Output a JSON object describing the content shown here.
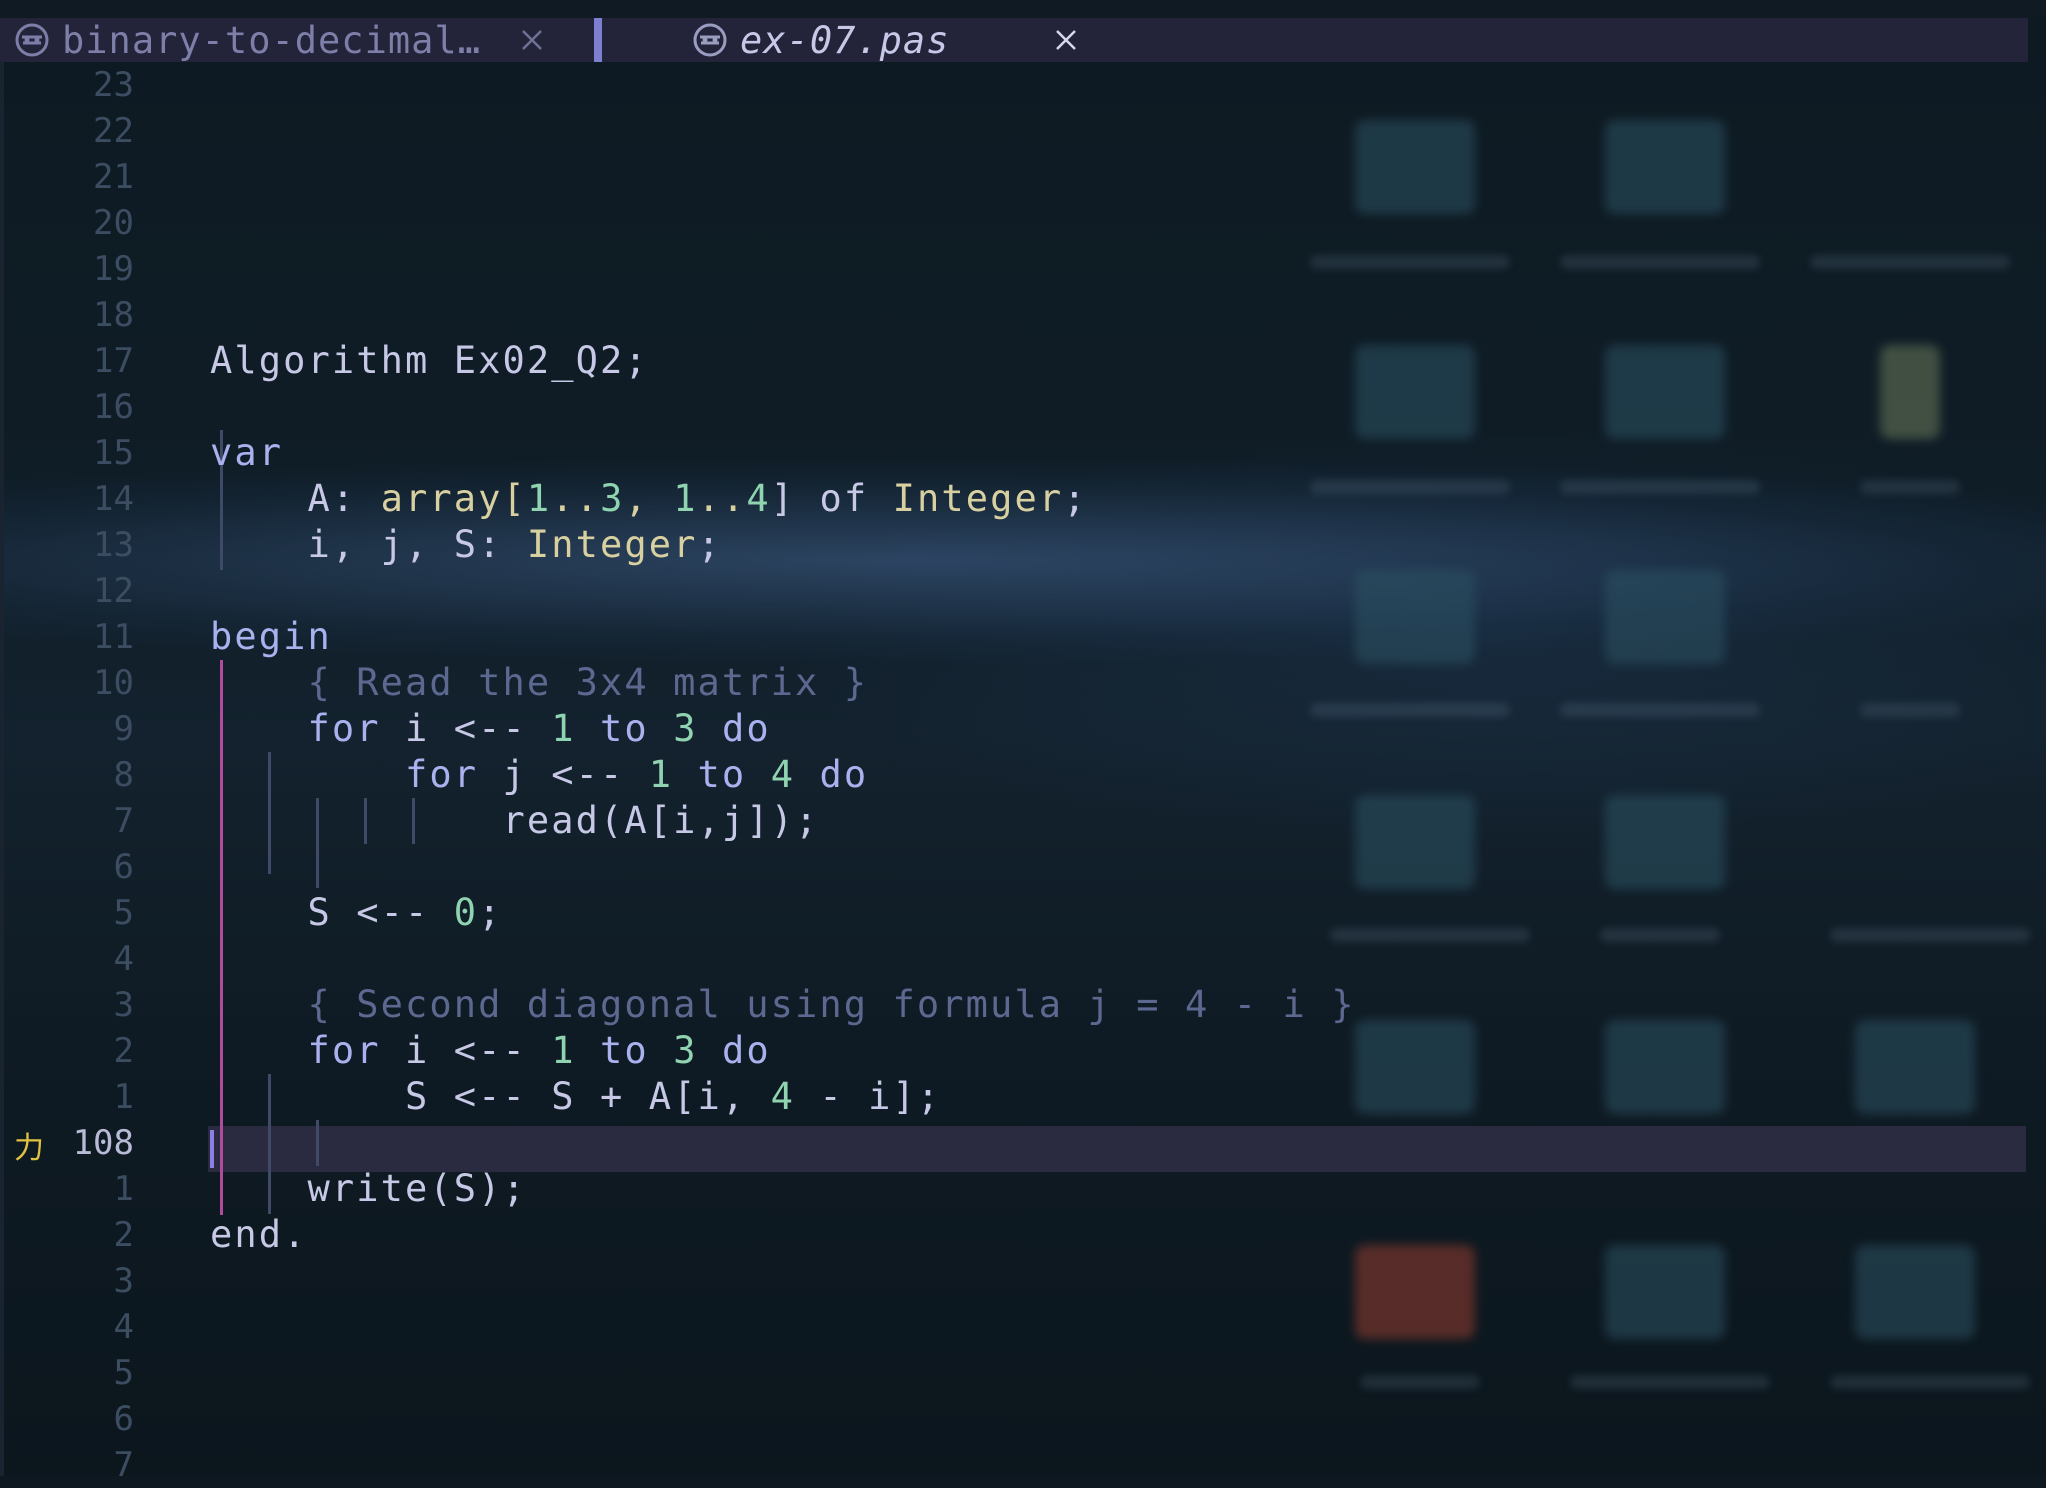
{
  "tabs": [
    {
      "label": "binary-to-decimal…",
      "active": false
    },
    {
      "label": "ex-07.pas",
      "active": true
    }
  ],
  "gutter": {
    "cursor_marker": "力",
    "numbers": [
      "23",
      "22",
      "21",
      "20",
      "19",
      "18",
      "17",
      "16",
      "15",
      "14",
      "13",
      "12",
      "11",
      "10",
      "9",
      "8",
      "7",
      "6",
      "5",
      "4",
      "3",
      "2",
      "1",
      "108",
      "1",
      "2",
      "3",
      "4",
      "5",
      "6",
      "7"
    ]
  },
  "code": {
    "l17": "Algorithm Ex02_Q2;",
    "l15": "var",
    "l14": {
      "a": "    A: ",
      "b": "array[",
      "c": "1",
      "d": "..",
      "e": "3",
      "f": ", ",
      "g": "1",
      "h": "..",
      "i": "4",
      "j": "] of ",
      "k": "Integer",
      "l": ";"
    },
    "l13": {
      "a": "    i, j, S: ",
      "b": "Integer",
      "c": ";"
    },
    "l11": "begin",
    "l10": "    { Read the 3x4 matrix }",
    "l9": {
      "a": "    for",
      "b": " i <-- ",
      "c": "1",
      "d": " to ",
      "e": "3",
      "f": " do"
    },
    "l8": {
      "a": "        for",
      "b": " j <-- ",
      "c": "1",
      "d": " to ",
      "e": "4",
      "f": " do"
    },
    "l7": "            read(A[i,j]);",
    "l5": {
      "a": "    S <-- ",
      "b": "0",
      "c": ";"
    },
    "l3": "    { Second diagonal using formula j = 4 - i }",
    "l2": {
      "a": "    for",
      "b": " i <-- ",
      "c": "1",
      "d": " to ",
      "e": "3",
      "f": " do"
    },
    "l1": {
      "a": "        S <-- S + A[i, ",
      "b": "4",
      "c": " - i];"
    },
    "la1": "    write(S);",
    "la2": "end."
  },
  "colors": {
    "tab_bar": "#23233a",
    "keyword": "#a9b1ee",
    "type": "#d8d0a0",
    "number": "#8fd3b0",
    "comment": "#5d6890",
    "indent_guide": "#b04c9e",
    "cursor": "#8b7fe6"
  }
}
